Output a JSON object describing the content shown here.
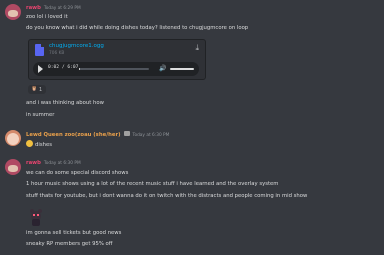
{
  "messages": [
    {
      "author": "rawb",
      "author_color": "#e8446f",
      "timestamp": "Today at 6:29 PM",
      "lines": [
        "zoo lol i loved it",
        "do you know what i did while doing dishes today? listened to chugjugmcore on loop"
      ],
      "attachment": {
        "filename": "chugjugmcore1.ogg",
        "size": "706 KB",
        "time": "0:02 / 6:07",
        "progress": 0.01
      },
      "reaction": {
        "count": "1"
      },
      "after_lines": [
        "and i was thinking about how",
        "in summer"
      ]
    },
    {
      "author": "Lewd Queen zoo(zoau (she/her)",
      "author_color": "#e9a04b",
      "timestamp": "Today at 6:30 PM",
      "lines": [
        "dishes"
      ]
    },
    {
      "author": "rawb",
      "author_color": "#e8446f",
      "timestamp": "Today at 6:30 PM",
      "lines": [
        "we can do some special discord shows",
        "1 hour music shows using a lot of the recent music stuff i have learned and the overlay system",
        "stuff thats for youtube, but i dont wanna do it on twitch with the distracts and people coming in mid show"
      ],
      "after_lines": [
        "im gonna sell tickets but good news",
        "sneaky RP members get 95% off"
      ]
    }
  ],
  "icons": {
    "file": "file-icon",
    "download": "download-icon",
    "play": "play-icon",
    "volume": "volume-icon",
    "reaction_emoji": "emoji-icon",
    "sticker": "bear-sticker"
  }
}
